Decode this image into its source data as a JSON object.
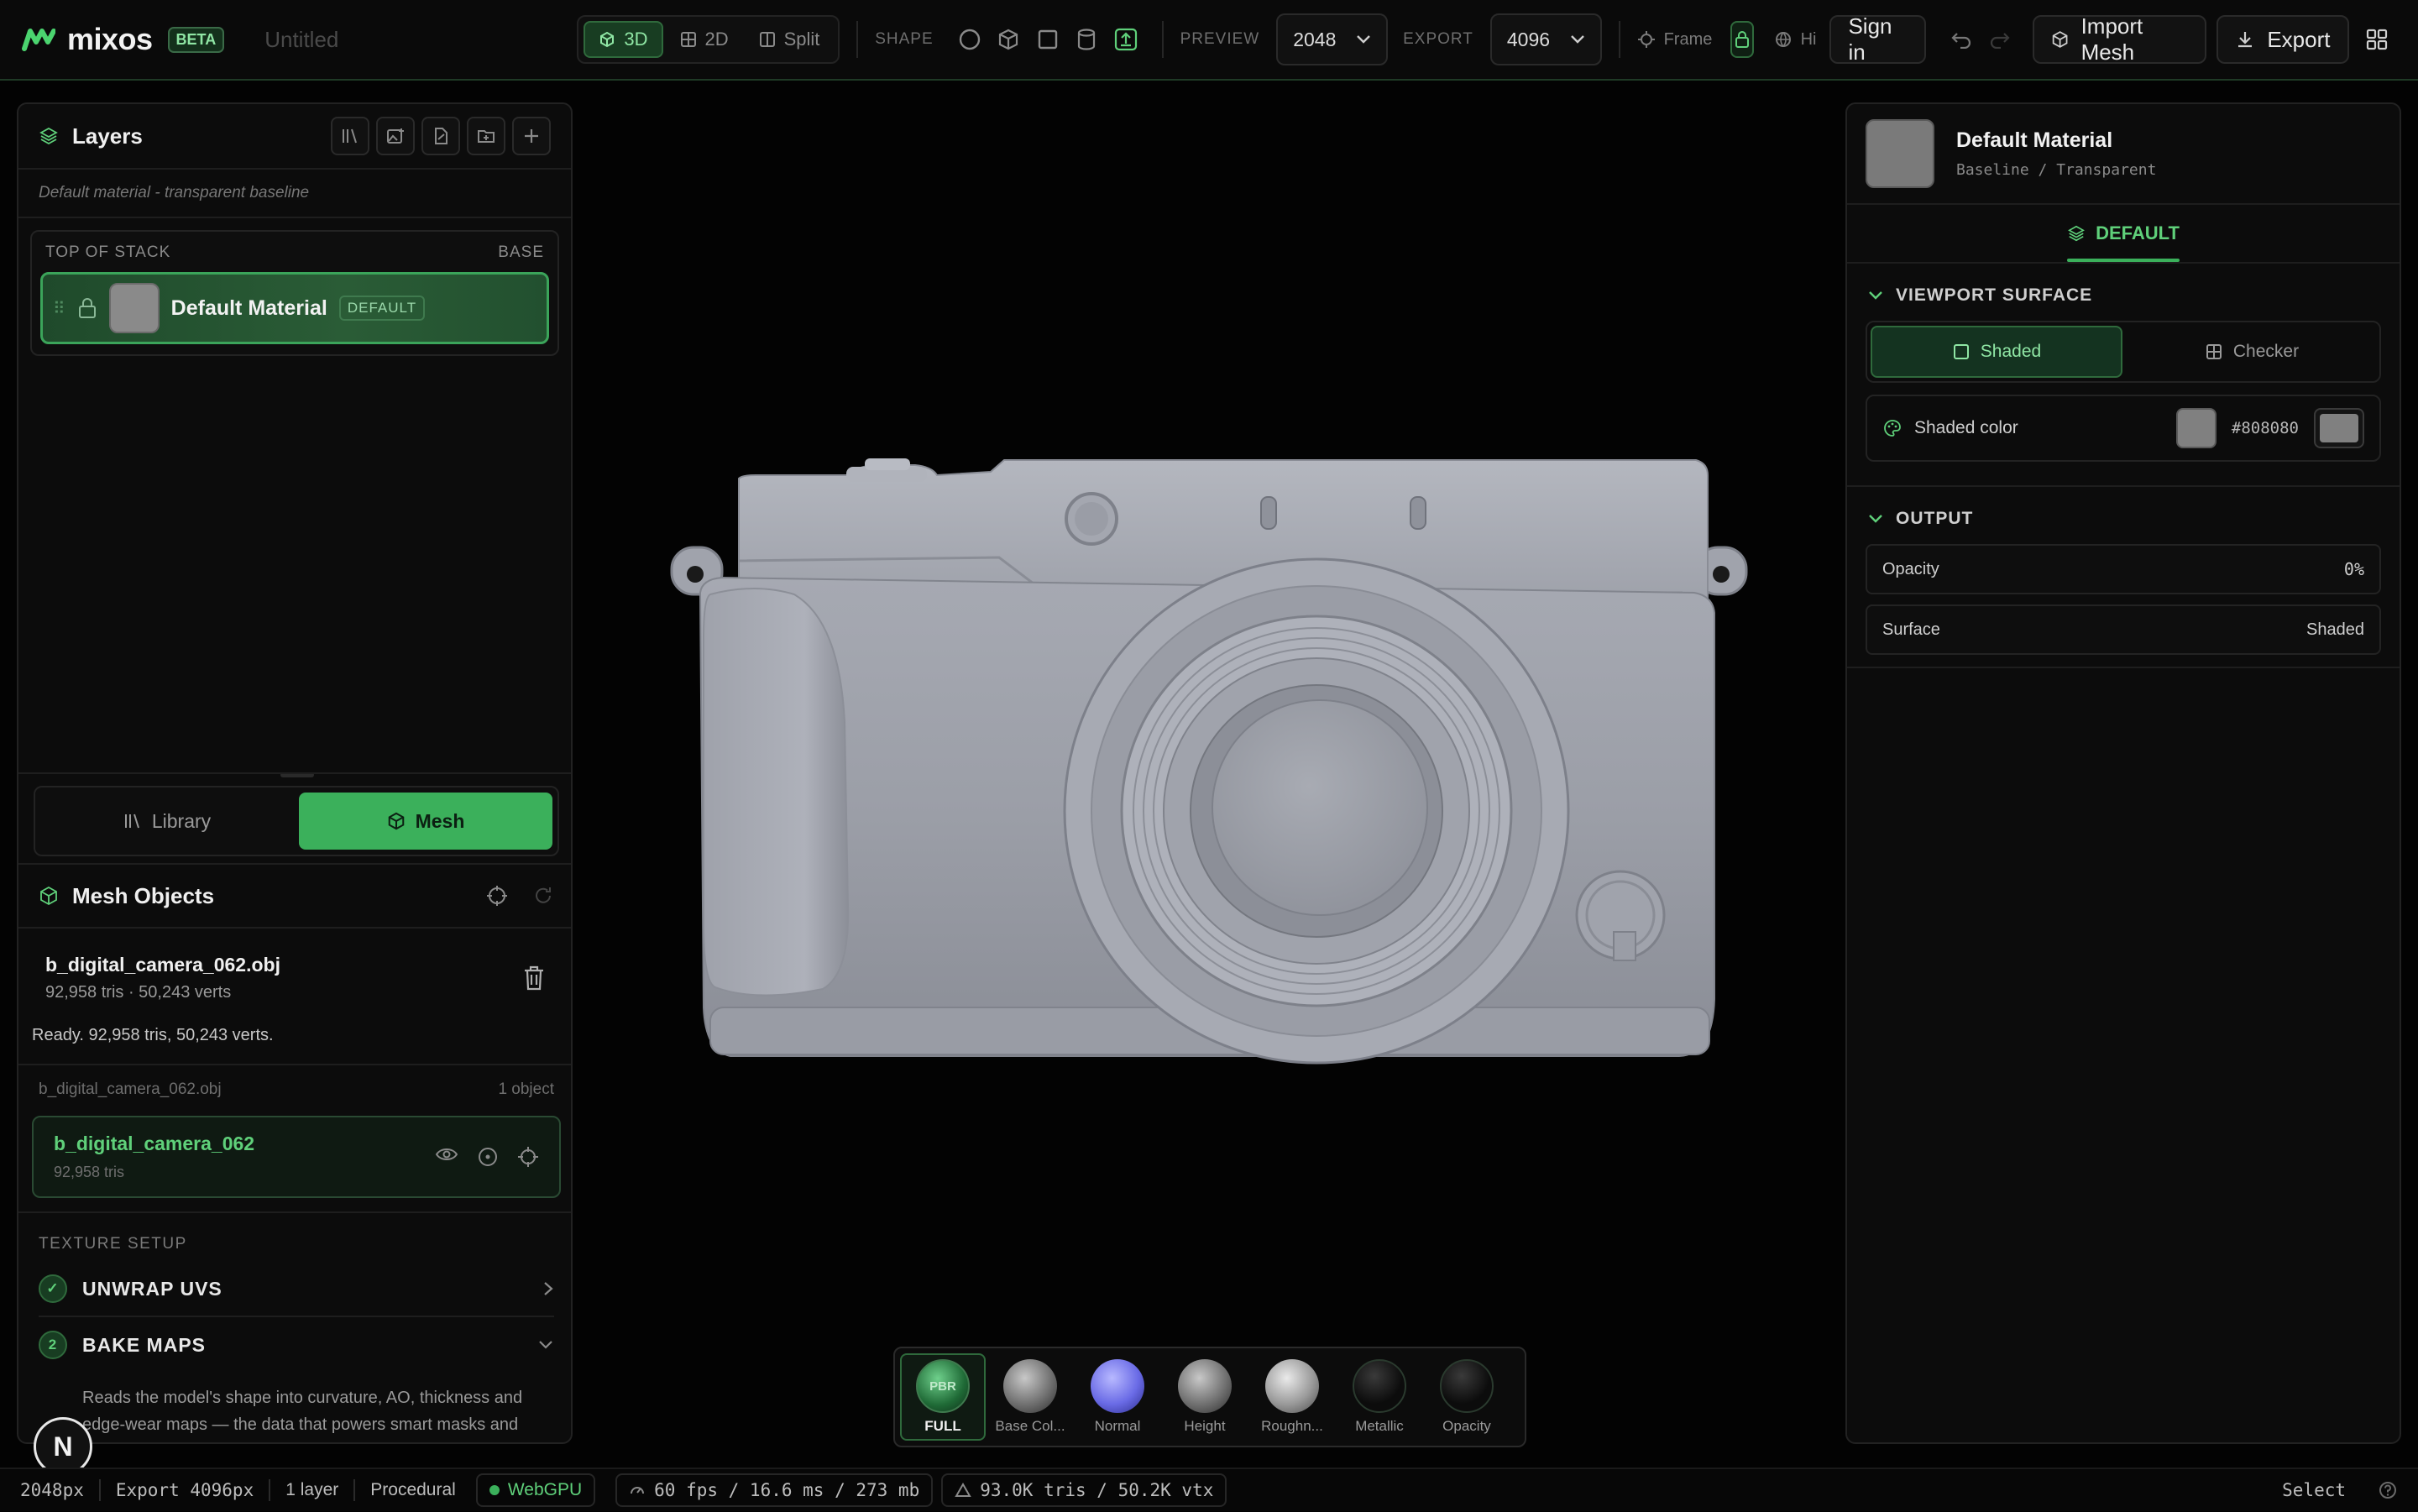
{
  "app": {
    "name": "mixos",
    "badge": "BETA",
    "doc_title": "Untitled"
  },
  "toolbar": {
    "view_modes": [
      {
        "label": "3D",
        "active": true
      },
      {
        "label": "2D",
        "active": false
      },
      {
        "label": "Split",
        "active": false
      }
    ],
    "shape_label": "SHAPE",
    "shapes": [
      "sphere-icon",
      "cube-icon",
      "plane-icon",
      "cylinder-icon",
      "upload-mesh-icon"
    ],
    "preview_label": "PREVIEW",
    "preview_value": "2048",
    "export_label": "EXPORT",
    "export_value": "4096",
    "frame_label": "Frame",
    "hi_label": "Hi",
    "sign_in": "Sign in",
    "import_mesh": "Import Mesh",
    "export": "Export"
  },
  "layers": {
    "title": "Layers",
    "note": "Default material - transparent baseline",
    "stack_top": "TOP OF STACK",
    "stack_base": "BASE",
    "items": [
      {
        "name": "Default Material",
        "tag": "DEFAULT"
      }
    ]
  },
  "library_mesh": {
    "library": "Library",
    "mesh": "Mesh",
    "active": "Mesh"
  },
  "mesh": {
    "title": "Mesh Objects",
    "file_name": "b_digital_camera_062.obj",
    "file_meta": "92,958 tris · 50,243 verts",
    "ready": "Ready. 92,958 tris, 50,243 verts.",
    "group_name": "b_digital_camera_062.obj",
    "group_count": "1 object",
    "object_name": "b_digital_camera_062",
    "object_tris": "92,958 tris"
  },
  "texture_setup": {
    "title": "TEXTURE SETUP",
    "steps": [
      {
        "badge": "✓",
        "label": "UNWRAP UVS"
      },
      {
        "badge": "2",
        "label": "BAKE MAPS",
        "desc": "Reads the model's shape into curvature, AO, thickness and edge-wear maps — the data that powers smart masks and weathering."
      }
    ]
  },
  "material": {
    "name": "Default Material",
    "sub": "Baseline / Transparent",
    "tab": "DEFAULT",
    "viewport_surface_title": "VIEWPORT SURFACE",
    "surface_options": [
      "Shaded",
      "Checker"
    ],
    "surface_active": "Shaded",
    "shaded_color_label": "Shaded color",
    "shaded_color_hex": "#808080",
    "output_title": "OUTPUT",
    "opacity_label": "Opacity",
    "opacity_value": "0%",
    "surface_label": "Surface",
    "surface_value": "Shaded"
  },
  "channels": [
    {
      "label": "FULL",
      "color": "#3b8a52"
    },
    {
      "label": "Base Col...",
      "color": "#8c8c8c"
    },
    {
      "label": "Normal",
      "color": "#7b7cf0"
    },
    {
      "label": "Height",
      "color": "#8c8c8c"
    },
    {
      "label": "Roughn...",
      "color": "#b0b0b0"
    },
    {
      "label": "Metallic",
      "color": "#151515"
    },
    {
      "label": "Opacity",
      "color": "#151515"
    }
  ],
  "status": {
    "res": "2048px",
    "export": "Export 4096px",
    "layers": "1 layer",
    "mode": "Procedural",
    "backend": "WebGPU",
    "fps": "60 fps / 16.6 ms / 273 mb",
    "tris": "93.0K tris / 50.2K vtx",
    "tool": "Select"
  },
  "colors": {
    "accent": "#3bb05b",
    "accent_text": "#5fd07a",
    "bg": "#030303",
    "mesh": "#9c9fa8"
  }
}
